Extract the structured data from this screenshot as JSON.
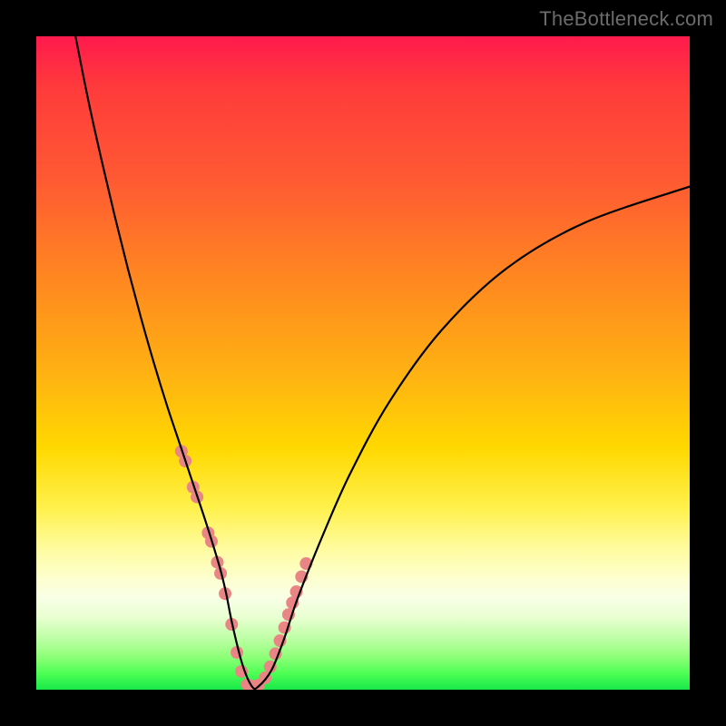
{
  "watermark": "TheBottleneck.com",
  "chart_data": {
    "type": "line",
    "title": "",
    "xlabel": "",
    "ylabel": "",
    "xlim": [
      0,
      100
    ],
    "ylim": [
      0,
      100
    ],
    "series": [
      {
        "name": "bottleneck-curve",
        "x": [
          6,
          8,
          10,
          12,
          14,
          16,
          18,
          20,
          22,
          24,
          26,
          28,
          29,
          30,
          31.5,
          33,
          34,
          36,
          38,
          40,
          44,
          48,
          54,
          62,
          72,
          84,
          100
        ],
        "y": [
          100,
          90,
          81,
          72.5,
          64.5,
          57,
          50,
          43.5,
          37.5,
          31.5,
          25.5,
          19,
          15,
          10,
          4,
          0.5,
          0.5,
          3,
          8,
          14,
          24,
          33,
          44,
          55,
          64.5,
          71.5,
          77
        ],
        "color": "#000000"
      },
      {
        "name": "highlight-dots",
        "type": "scatter",
        "x": [
          22.2,
          22.8,
          24.0,
          24.6,
          26.3,
          26.8,
          27.7,
          28.2,
          28.9,
          29.9,
          30.7,
          31.4,
          32.3,
          33.1,
          34.0,
          35.0,
          35.8,
          36.6,
          37.3,
          38.0,
          38.6,
          39.2,
          39.8,
          40.6,
          41.3
        ],
        "y": [
          36.5,
          35.0,
          31.0,
          29.5,
          24.0,
          22.7,
          19.5,
          17.8,
          14.7,
          10.0,
          5.7,
          2.8,
          0.8,
          0.5,
          0.7,
          1.8,
          3.5,
          5.5,
          7.5,
          9.5,
          11.5,
          13.3,
          15.0,
          17.3,
          19.3
        ],
        "color": "#e98585",
        "radius_px": 7
      }
    ],
    "background_gradient": {
      "top": "#ff1a4d",
      "mid": "#ffd800",
      "bottom": "#17e84a"
    }
  }
}
